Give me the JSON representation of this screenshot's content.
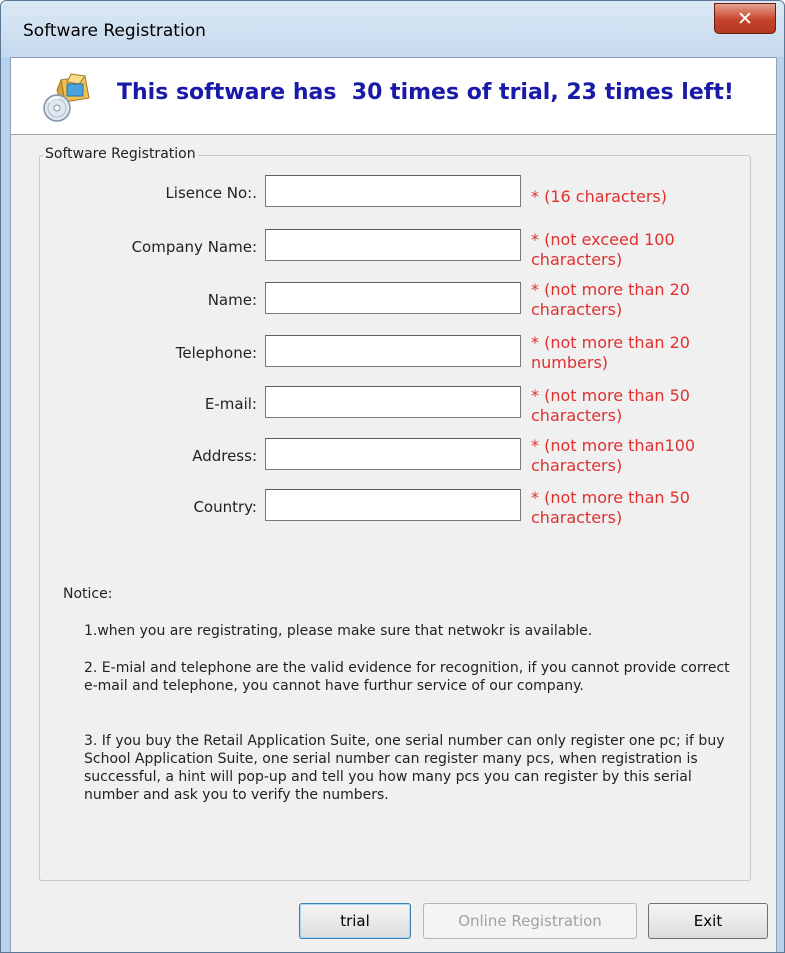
{
  "window": {
    "title": "Software Registration"
  },
  "banner": {
    "icon": "software-box-cd-icon",
    "message": "This software has  30 times of trial, 23 times left!",
    "color": "#1a1aa8"
  },
  "group": {
    "legend": "Software Registration"
  },
  "fields": [
    {
      "label": "Lisence No:.",
      "value": "",
      "hint": "* (16 characters)"
    },
    {
      "label": "Company Name:",
      "value": "",
      "hint": "* (not exceed 100 characters)"
    },
    {
      "label": "Name:",
      "value": "",
      "hint": "* (not more than 20 characters)"
    },
    {
      "label": "Telephone:",
      "value": "",
      "hint": "* (not more than 20 numbers)"
    },
    {
      "label": "E-mail:",
      "value": "",
      "hint": "* (not more than 50 characters)"
    },
    {
      "label": "Address:",
      "value": "",
      "hint": "* (not more than100 characters)"
    },
    {
      "label": "Country:",
      "value": "",
      "hint": "* (not more than 50 characters)"
    }
  ],
  "notice": {
    "title": "Notice:",
    "items": [
      "1.when you are registrating, please make sure that netwokr is available.",
      "2. E-mial and telephone are the valid evidence for recognition, if you cannot provide correct e-mail and telephone, you cannot have furthur service of our company.",
      "3. If you buy the Retail Application Suite, one serial number can only register one pc; if buy School Application Suite, one serial number can register many pcs, when registration is successful, a hint will pop-up and tell you how many pcs you can register by this serial number and ask you to verify the numbers."
    ]
  },
  "buttons": {
    "trial": "trial",
    "online_registration": "Online Registration",
    "exit": "Exit"
  },
  "colors": {
    "hint": "#e03030",
    "window_frame": "#b9d1ea",
    "close": "#c5442a"
  }
}
